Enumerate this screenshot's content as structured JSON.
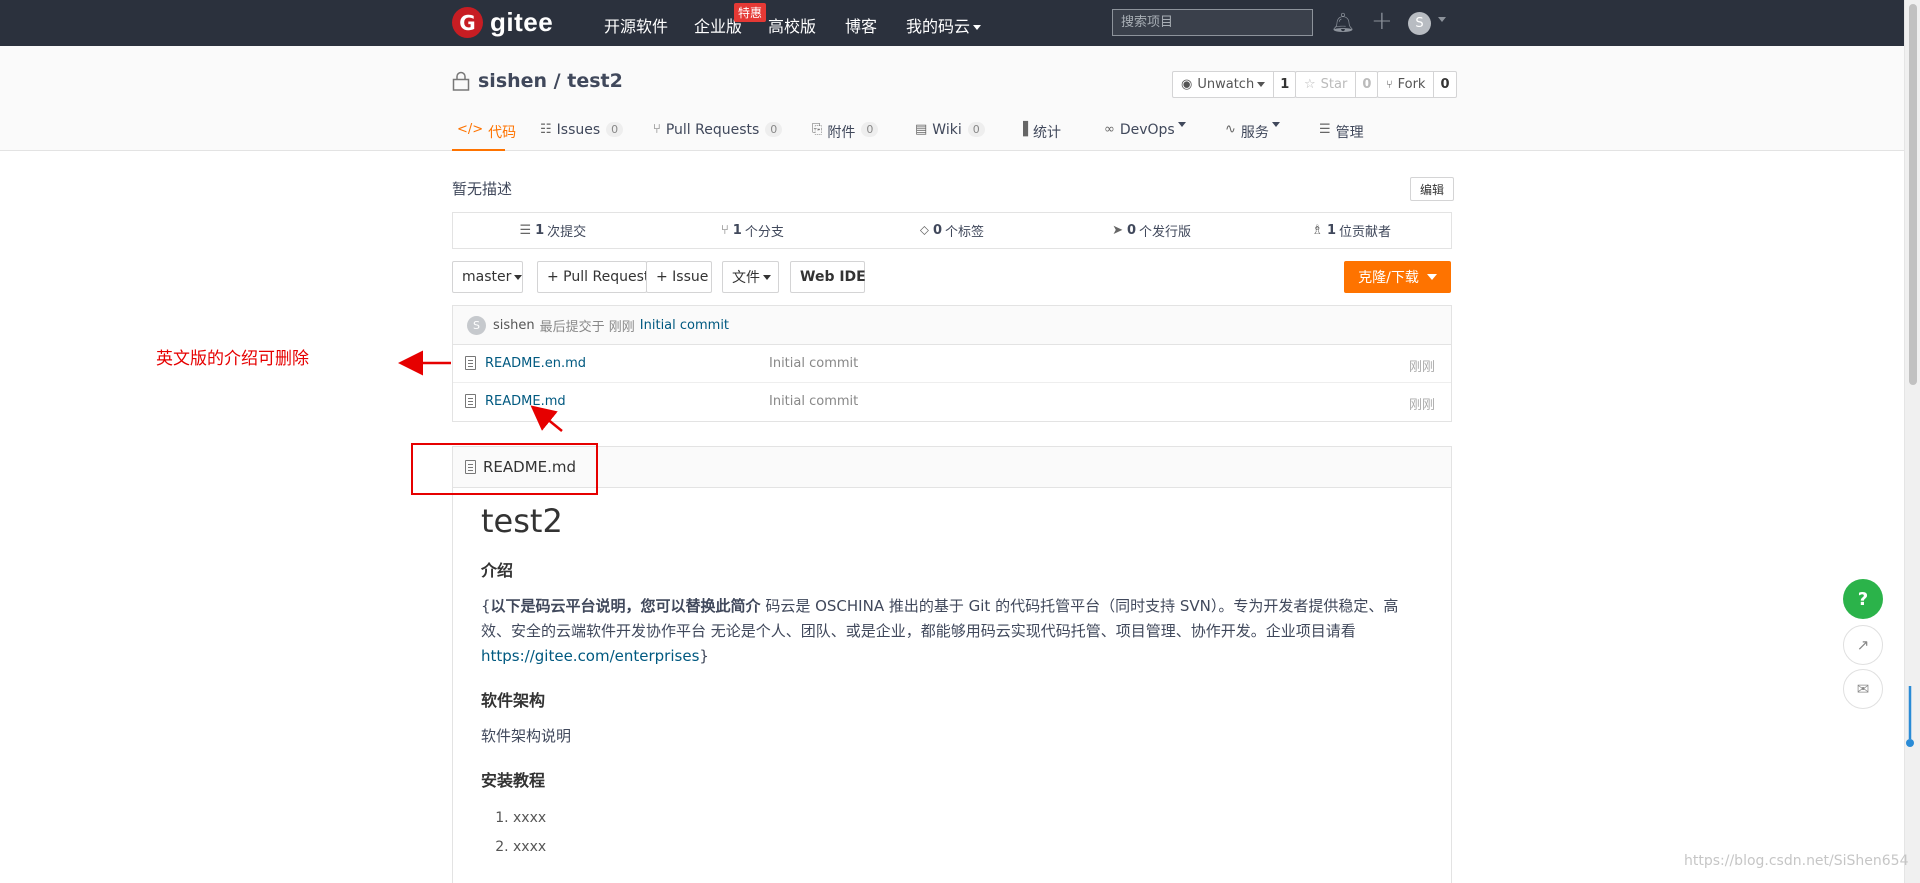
{
  "nav": {
    "logo_letter": "G",
    "logo_text": "gitee",
    "items": [
      "开源软件",
      "企业版",
      "高校版",
      "博客",
      "我的码云"
    ],
    "badge": "特惠",
    "search_placeholder": "搜索项目",
    "avatar_letter": "S"
  },
  "repo": {
    "title": "sishen / test2",
    "watch": {
      "label": "Unwatch",
      "count": "1"
    },
    "star": {
      "label": "Star",
      "count": "0"
    },
    "fork": {
      "label": "Fork",
      "count": "0"
    },
    "tabs": [
      {
        "label": "代码",
        "icon": "code-icon",
        "active": true
      },
      {
        "label": "Issues",
        "count": "0",
        "icon": "issues-icon"
      },
      {
        "label": "Pull Requests",
        "count": "0",
        "icon": "pull-request-icon"
      },
      {
        "label": "附件",
        "count": "0",
        "icon": "attachment-icon"
      },
      {
        "label": "Wiki",
        "count": "0",
        "icon": "wiki-icon"
      },
      {
        "label": "统计",
        "icon": "chart-icon"
      },
      {
        "label": "DevOps",
        "icon": "devops-icon"
      },
      {
        "label": "服务",
        "icon": "service-icon"
      },
      {
        "label": "管理",
        "icon": "manage-icon"
      }
    ],
    "description": "暂无描述",
    "edit_label": "编辑"
  },
  "stats": [
    {
      "count": "1",
      "label": "次提交",
      "icon": "commit-icon"
    },
    {
      "count": "1",
      "label": "个分支",
      "icon": "branch-icon"
    },
    {
      "count": "0",
      "label": "个标签",
      "icon": "tag-icon"
    },
    {
      "count": "0",
      "label": "个发行版",
      "icon": "release-icon"
    },
    {
      "count": "1",
      "label": "位贡献者",
      "icon": "contributor-icon"
    }
  ],
  "actions": {
    "branch": "master",
    "pull_request": "+ Pull Request",
    "issue": "+ Issue",
    "file": "文件",
    "web_ide": "Web IDE",
    "clone": "克隆/下载"
  },
  "files": {
    "commit": {
      "avatar": "S",
      "author": "sishen",
      "meta": "最后提交于 刚刚",
      "message": "Initial commit"
    },
    "rows": [
      {
        "name": "README.en.md",
        "message": "Initial commit",
        "time": "刚刚"
      },
      {
        "name": "README.md",
        "message": "Initial commit",
        "time": "刚刚"
      }
    ]
  },
  "readme": {
    "filename": "README.md",
    "h1": "test2",
    "intro_heading": "介绍",
    "intro_brace_open": "{",
    "intro_bold": "以下是码云平台说明，您可以替换此简介",
    "intro_text": " 码云是 OSCHINA 推出的基于 Git 的代码托管平台（同时支持 SVN）。专为开发者提供稳定、高效、安全的云端软件开发协作平台 无论是个人、团队、或是企业，都能够用码云实现代码托管、项目管理、协作开发。企业项目请看 ",
    "intro_link": "https://gitee.com/enterprises",
    "intro_brace_close": "}",
    "arch_heading": "软件架构",
    "arch_text": "软件架构说明",
    "install_heading": "安装教程",
    "install_steps": [
      "xxxx",
      "xxxx"
    ]
  },
  "annotation": {
    "text": "英文版的介绍可删除"
  },
  "floating": {
    "help": "?"
  },
  "watermark": "https://blog.csdn.net/SiShen654",
  "colors": {
    "brand": "#c71d23",
    "accent": "#fe7300",
    "navbar": "#2b313d",
    "link": "#005980",
    "annotation": "#e60000",
    "help": "#2bb34a"
  }
}
